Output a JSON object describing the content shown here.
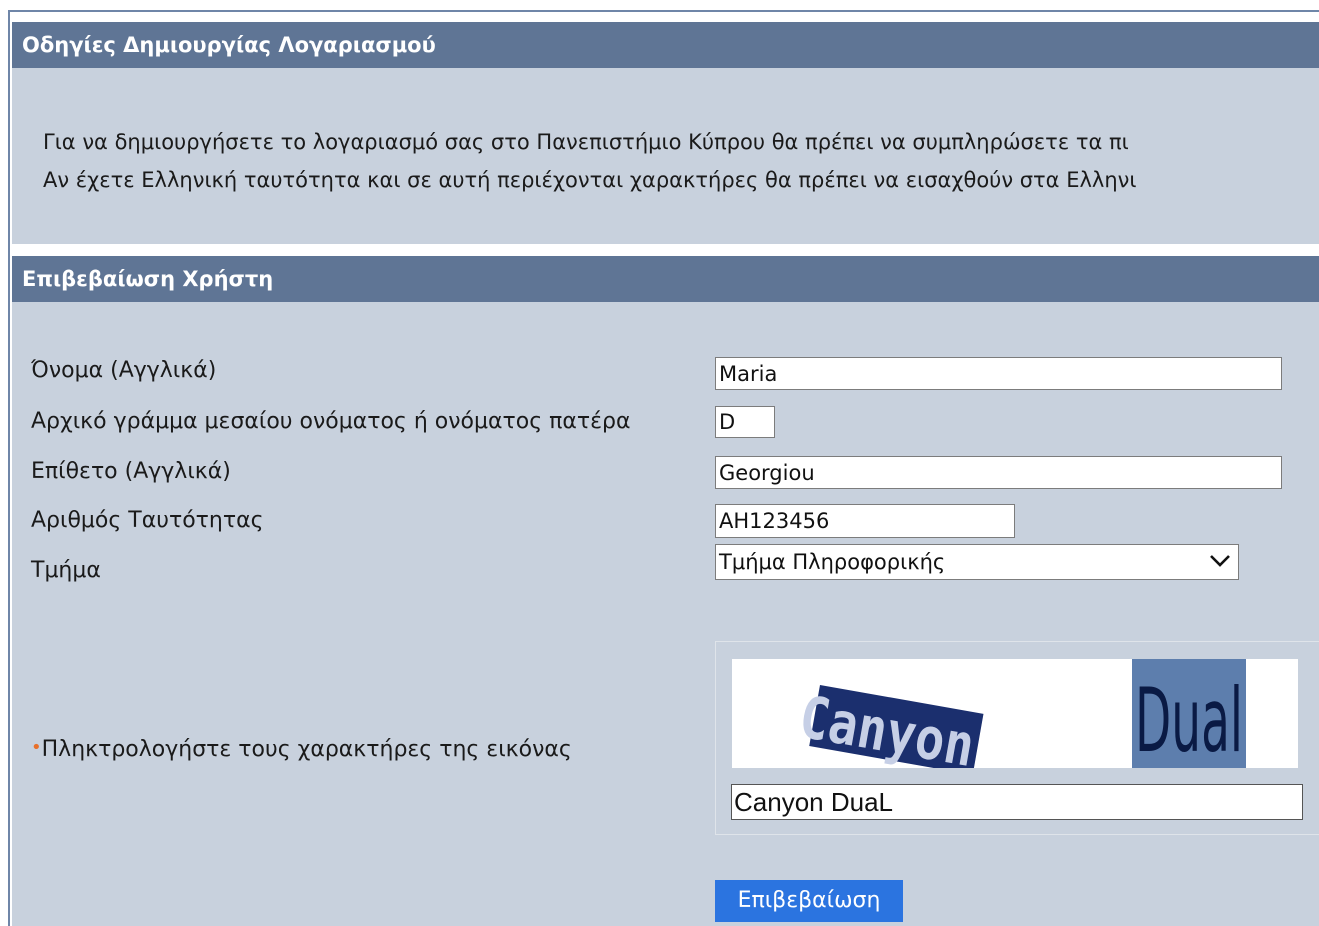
{
  "instructions": {
    "header": "Οδηγίες Δημιουργίας Λογαριασμού",
    "line1": "Για να δημιουργήσετε το λογαριασμό σας στο Πανεπιστήμιο Κύπρου θα πρέπει να συμπληρώσετε τα πι",
    "line2": "Αν έχετε Ελληνική ταυτότητα και σε αυτή περιέχονται χαρακτήρες θα πρέπει να εισαχθούν στα Ελληνι"
  },
  "verification": {
    "header": "Επιβεβαίωση Χρήστη",
    "fields": {
      "first_name": {
        "label": "Όνομα (Αγγλικά)",
        "value": "Maria"
      },
      "middle_initial": {
        "label": "Αρχικό γράμμα μεσαίου ονόματος ή ονόματος πατέρα",
        "value": "D"
      },
      "surname": {
        "label": "Επίθετο (Αγγλικά)",
        "value": "Georgiou"
      },
      "id_number": {
        "label": "Αριθμός Ταυτότητας",
        "value": "AH123456"
      },
      "department": {
        "label": "Τμήμα",
        "selected": "Τμήμα Πληροφορικής"
      }
    },
    "captcha": {
      "bullet": "•",
      "label": "Πληκτρολογήστε τους χαρακτήρες της εικόνας",
      "image_words": [
        "Canyon",
        "Dual"
      ],
      "value": "Canyon DuaL"
    },
    "submit_label": "Επιβεβαίωση"
  },
  "colors": {
    "header_bg": "#5f7595",
    "panel_bg": "#c8d1dd",
    "button_bg": "#2b74e0",
    "bullet": "#e8702a"
  },
  "icons": {
    "select_arrow": "chevron-down-icon"
  }
}
